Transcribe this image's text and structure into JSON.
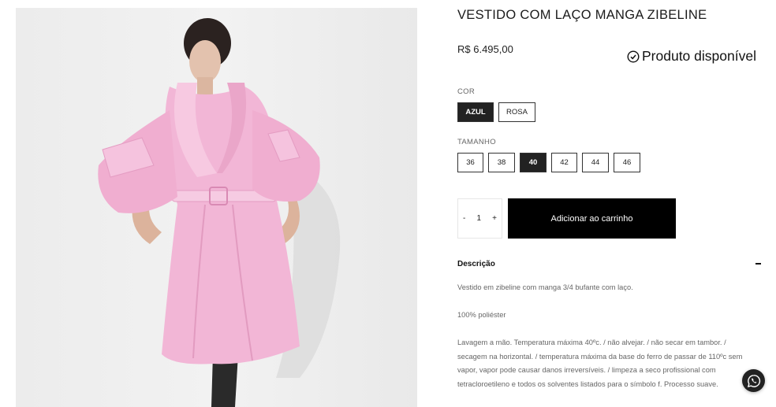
{
  "product": {
    "title": "VESTIDO COM LAÇO MANGA ZIBELINE",
    "price": "R$ 6.495,00",
    "availability": "Produto disponível",
    "image_alt": "model wearing pink satin dress with bow sleeves"
  },
  "color": {
    "label": "COR",
    "options": [
      "AZUL",
      "ROSA"
    ],
    "selected": "AZUL"
  },
  "size": {
    "label": "TAMANHO",
    "options": [
      "36",
      "38",
      "40",
      "42",
      "44",
      "46"
    ],
    "selected": "40"
  },
  "cart": {
    "minus": "-",
    "quantity": "1",
    "plus": "+",
    "add_label": "Adicionar ao carrinho"
  },
  "description": {
    "label": "Descrição",
    "paragraphs": [
      "Vestido em zibeline com manga 3/4 bufante com laço.",
      "100% poliéster",
      "Lavagem a mão. Temperatura máxima 40ºc. / não alvejar. / não secar em tambor. / secagem na horizontal. / temperatura máxima da base do ferro de passar de 110ºc sem vapor, vapor pode causar danos irreversíveis. / limpeza a seco profissional com tetracloroetileno e todos os solventes listados para o símbolo f. Processo suave."
    ]
  },
  "icons": {
    "availability": "check-circle-icon",
    "collapse": "minus-icon",
    "chat": "whatsapp-icon"
  },
  "colors": {
    "selected_bg": "#222222",
    "button_bg": "#000000",
    "dress_pink": "#f2b6d6"
  }
}
